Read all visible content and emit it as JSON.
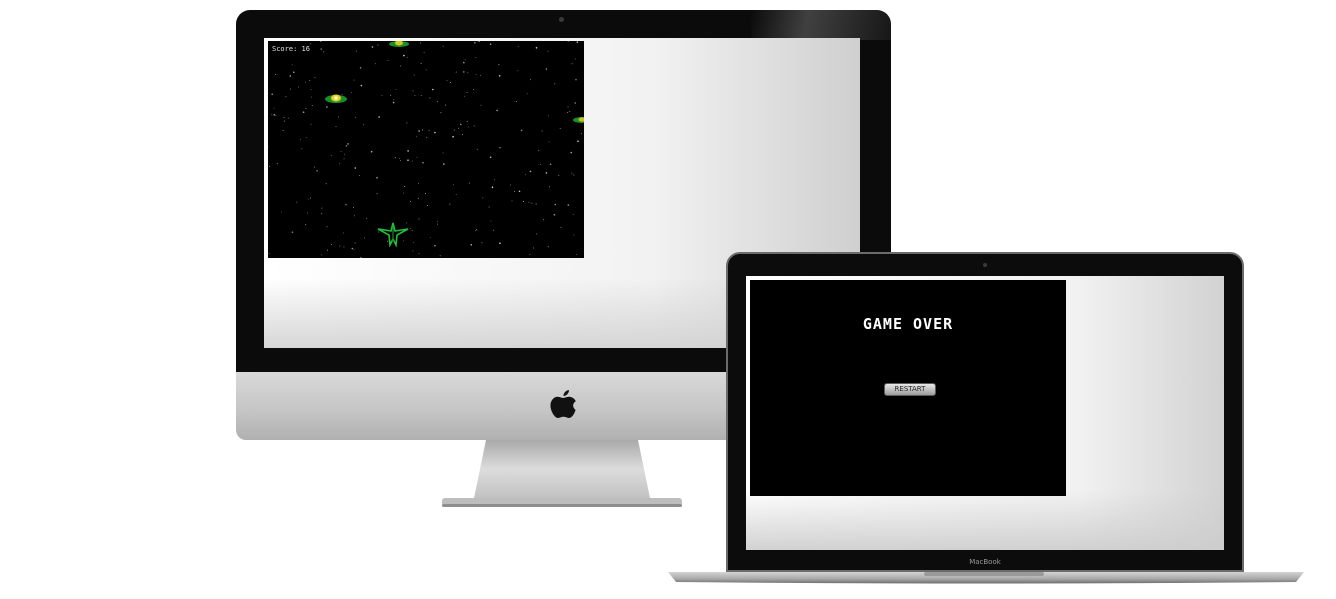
{
  "imac": {
    "game": {
      "score_text": "Score: 16"
    }
  },
  "macbook": {
    "brand": "MacBook",
    "game_over": {
      "title": "GAME OVER",
      "restart_label": "RESTART"
    }
  },
  "colors": {
    "game_background": "#000000",
    "sprite_green": "#1fbf3a",
    "sprite_yellow": "#e6d21e",
    "bezel": "#0b0b0b",
    "aluminum": "#c8c8c8"
  },
  "icons": {
    "logo": "apple-logo-icon",
    "player": "player-ship-icon",
    "enemy": "enemy-ship-icon"
  }
}
